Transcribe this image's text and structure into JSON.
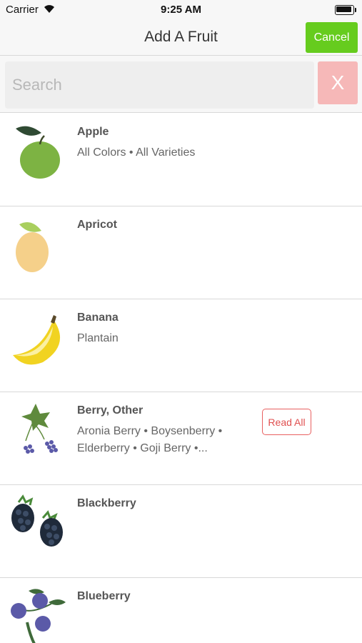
{
  "status": {
    "carrier": "Carrier",
    "time": "9:25 AM"
  },
  "nav": {
    "title": "Add A Fruit",
    "cancel_label": "Cancel"
  },
  "search": {
    "placeholder": "Search",
    "value": "",
    "clear_label": "X"
  },
  "fruits": [
    {
      "name": "Apple",
      "subtitle": "All Colors • All Varieties",
      "icon": "apple-icon"
    },
    {
      "name": "Apricot",
      "subtitle": "",
      "icon": "apricot-icon"
    },
    {
      "name": "Banana",
      "subtitle": "Plantain",
      "icon": "banana-icon"
    },
    {
      "name": "Berry, Other",
      "subtitle": "Aronia Berry • Boysenberry • Elderberry • Goji Berry •...",
      "icon": "berry-branch-icon",
      "action_label": "Read All"
    },
    {
      "name": "Blackberry",
      "subtitle": "",
      "icon": "blackberry-icon"
    },
    {
      "name": "Blueberry",
      "subtitle": "",
      "icon": "blueberry-icon"
    }
  ],
  "colors": {
    "cancel": "#66cc1e",
    "clear": "#f6b8b8",
    "read_all": "#e86060"
  }
}
